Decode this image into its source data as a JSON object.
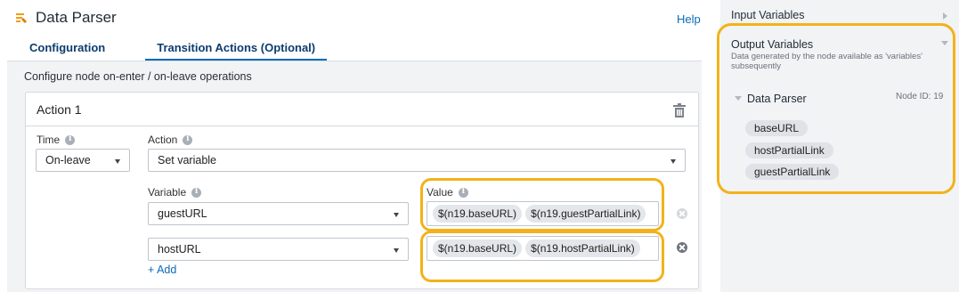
{
  "header": {
    "title": "Data Parser",
    "help_label": "Help"
  },
  "tabs": [
    {
      "label": "Configuration",
      "active": false
    },
    {
      "label": "Transition Actions (Optional)",
      "active": true
    }
  ],
  "subtitle": "Configure node on-enter / on-leave operations",
  "action": {
    "title": "Action 1",
    "time_label": "Time",
    "time_value": "On-leave",
    "action_label": "Action",
    "action_value": "Set variable",
    "variable_label": "Variable",
    "value_label": "Value",
    "rows": [
      {
        "variable": "guestURL",
        "chips": [
          "$(n19.baseURL)",
          "$(n19.guestPartialLink)"
        ]
      },
      {
        "variable": "hostURL",
        "chips": [
          "$(n19.baseURL)",
          "$(n19.hostPartialLink)"
        ]
      }
    ],
    "add_label": "+ Add"
  },
  "side_panel": {
    "input_variables_label": "Input Variables",
    "output_variables_label": "Output Variables",
    "output_description": "Data generated by the node available as 'variables' subsequently",
    "node_name": "Data Parser",
    "node_id_label": "Node ID: 19",
    "variables": [
      "baseURL",
      "hostPartialLink",
      "guestPartialLink"
    ]
  },
  "colors": {
    "accent": "#0a6bb8",
    "highlight": "#f3b21a",
    "icon": "#f39c12"
  }
}
